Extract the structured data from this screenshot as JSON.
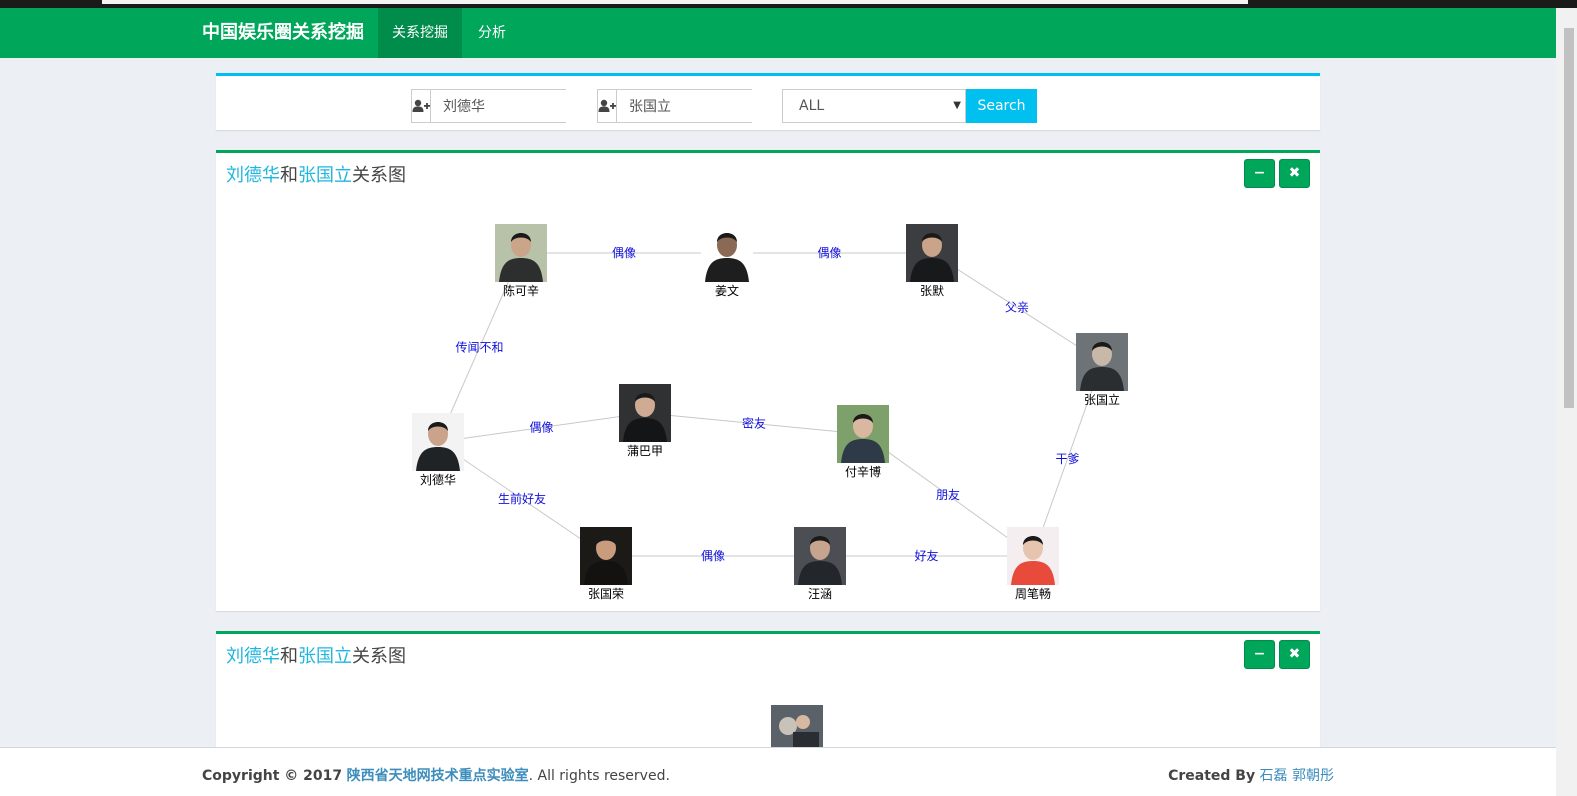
{
  "navbar": {
    "brand": "中国娱乐圈关系挖掘",
    "items": [
      {
        "label": "关系挖掘",
        "active": true
      },
      {
        "label": "分析",
        "active": false
      }
    ],
    "color": "#00a65a"
  },
  "search": {
    "person1": "刘德华",
    "person2": "张国立",
    "filter": "ALL",
    "button": "Search",
    "icon": "user-plus-icon"
  },
  "panels": [
    {
      "title_p1": "刘德华",
      "title_mid": "和",
      "title_p2": "张国立",
      "title_end": "关系图",
      "minimize_icon": "minus-icon",
      "close_icon": "times-icon",
      "nodes": [
        {
          "id": "chenkexin",
          "name": "陈可辛"
        },
        {
          "id": "jiangwen",
          "name": "姜文"
        },
        {
          "id": "zhangmo",
          "name": "张默"
        },
        {
          "id": "zhangguoli",
          "name": "张国立"
        },
        {
          "id": "liudehua",
          "name": "刘德华"
        },
        {
          "id": "pubajia",
          "name": "蒲巴甲"
        },
        {
          "id": "fuxinbo",
          "name": "付辛博"
        },
        {
          "id": "zhangguorong",
          "name": "张国荣"
        },
        {
          "id": "wanghan",
          "name": "汪涵"
        },
        {
          "id": "zhoubichang",
          "name": "周笔畅"
        }
      ],
      "edges": [
        {
          "from": "chenkexin",
          "to": "jiangwen",
          "label": "偶像"
        },
        {
          "from": "jiangwen",
          "to": "zhangmo",
          "label": "偶像"
        },
        {
          "from": "zhangmo",
          "to": "zhangguoli",
          "label": "父亲"
        },
        {
          "from": "liudehua",
          "to": "chenkexin",
          "label": "传闻不和"
        },
        {
          "from": "liudehua",
          "to": "pubajia",
          "label": "偶像"
        },
        {
          "from": "pubajia",
          "to": "fuxinbo",
          "label": "密友"
        },
        {
          "from": "liudehua",
          "to": "zhangguorong",
          "label": "生前好友"
        },
        {
          "from": "fuxinbo",
          "to": "zhoubichang",
          "label": "朋友"
        },
        {
          "from": "zhoubichang",
          "to": "zhangguoli",
          "label": "干爹"
        },
        {
          "from": "zhangguorong",
          "to": "wanghan",
          "label": "偶像"
        },
        {
          "from": "wanghan",
          "to": "zhoubichang",
          "label": "好友"
        }
      ]
    },
    {
      "title_p1": "刘德华",
      "title_mid": "和",
      "title_p2": "张国立",
      "title_end": "关系图",
      "minimize_icon": "minus-icon",
      "close_icon": "times-icon"
    }
  ],
  "footer": {
    "copyright": "Copyright © 2017",
    "lab": "陕西省天地网技术重点实验室",
    "rights": ". All rights reserved.",
    "created_by": "Created By",
    "authors": "石磊 郭朝彤"
  }
}
